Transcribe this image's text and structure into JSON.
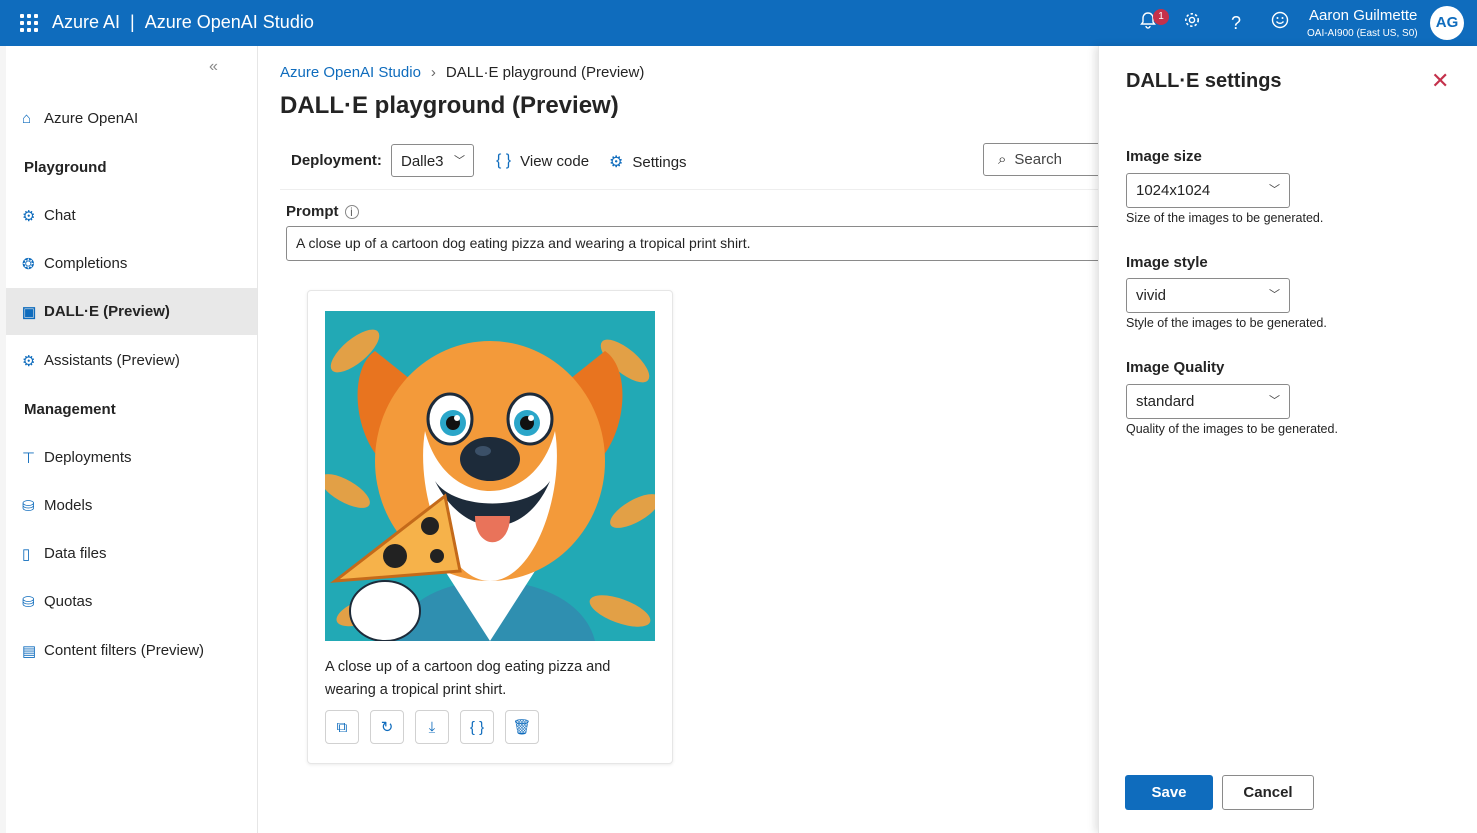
{
  "topbar": {
    "brand": "Azure AI",
    "separator": "|",
    "product": "Azure OpenAI Studio",
    "notification_count": "1",
    "user_name": "Aaron Guilmette",
    "user_sub": "OAI-AI900 (East US, S0)",
    "avatar_initials": "AG",
    "icons": [
      "waffle-icon",
      "bell-icon",
      "gear-icon",
      "help-icon",
      "smiley-icon"
    ]
  },
  "sidebar": {
    "collapse": "«",
    "items": [
      {
        "label": "Azure OpenAI",
        "icon": "home-icon"
      },
      {
        "label": "Playground",
        "type": "heading"
      },
      {
        "label": "Chat",
        "icon": "chat-icon"
      },
      {
        "label": "Completions",
        "icon": "completions-icon"
      },
      {
        "label": "DALL·E (Preview)",
        "icon": "image-icon",
        "active": true
      },
      {
        "label": "Assistants (Preview)",
        "icon": "assistant-icon"
      },
      {
        "label": "Management",
        "type": "heading"
      },
      {
        "label": "Deployments",
        "icon": "deployments-icon"
      },
      {
        "label": "Models",
        "icon": "models-icon"
      },
      {
        "label": "Data files",
        "icon": "data-files-icon"
      },
      {
        "label": "Quotas",
        "icon": "quotas-icon"
      },
      {
        "label": "Content filters (Preview)",
        "icon": "content-filter-icon"
      }
    ]
  },
  "main": {
    "breadcrumb_root": "Azure OpenAI Studio",
    "breadcrumb_current": "DALL·E playground (Preview)",
    "title": "DALL·E playground (Preview)",
    "deployment_label": "Deployment:",
    "deployment_value": "Dalle3",
    "view_code": "View code",
    "settings": "Settings",
    "search": "Search",
    "prompt_label": "Prompt",
    "prompt_value": "A close up of a cartoon dog eating pizza and wearing a tropical print shirt.",
    "card": {
      "caption": "A close up of a cartoon dog eating pizza and wearing a tropical print shirt.",
      "actions": [
        "copy-icon",
        "regenerate-icon",
        "download-icon",
        "code-icon",
        "delete-icon"
      ]
    }
  },
  "panel": {
    "title": "DALL·E settings",
    "close": "✕",
    "image_size_label": "Image size",
    "image_size_value": "1024x1024",
    "image_size_help": "Size of the images to be generated.",
    "image_style_label": "Image style",
    "image_style_value": "vivid",
    "image_style_help": "Style of the images to be generated.",
    "image_quality_label": "Image Quality",
    "image_quality_value": "standard",
    "image_quality_help": "Quality of the images to be generated.",
    "save": "Save",
    "cancel": "Cancel"
  },
  "colors": {
    "accent": "#0f6cbd",
    "danger": "#c4314b"
  }
}
